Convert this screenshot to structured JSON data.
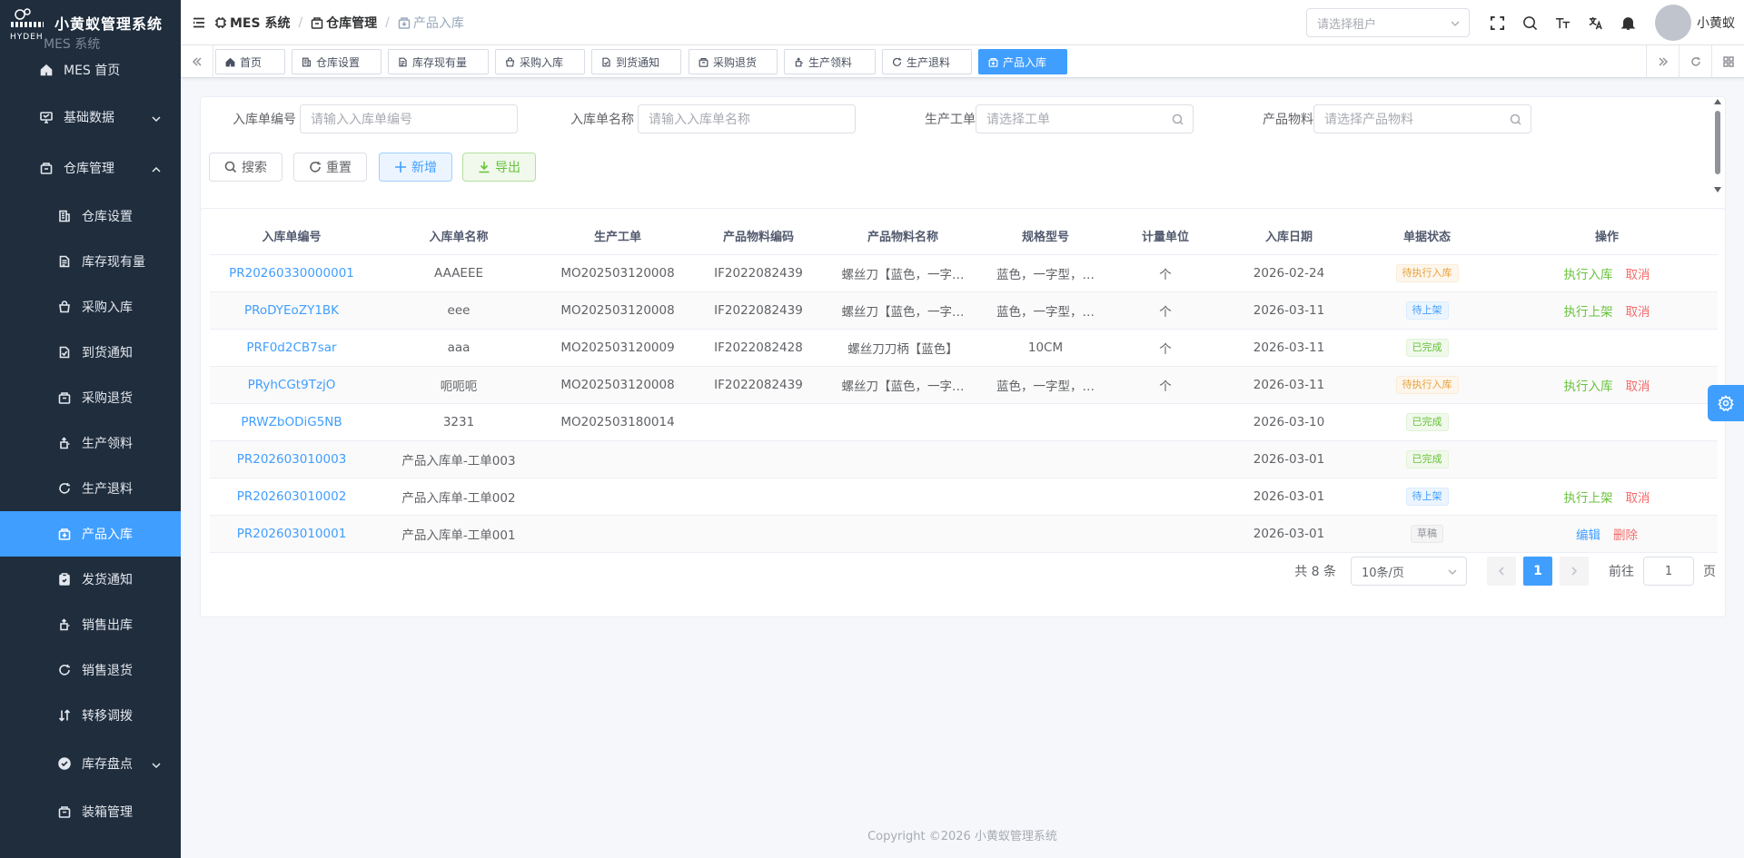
{
  "app": {
    "title": "小黄蚁管理系统",
    "logo_sub": "MES 系统"
  },
  "sidebar": {
    "items": [
      {
        "label": "MES 首页",
        "icon": "home-icon"
      },
      {
        "label": "基础数据",
        "icon": "monitor-icon",
        "expandable": true
      },
      {
        "label": "仓库管理",
        "icon": "warehouse-icon",
        "expandable": true,
        "expanded": true
      },
      {
        "label": "仓库设置",
        "icon": "building-icon",
        "sub": true
      },
      {
        "label": "库存现有量",
        "icon": "document-icon",
        "sub": true
      },
      {
        "label": "采购入库",
        "icon": "bag-icon",
        "sub": true
      },
      {
        "label": "到货通知",
        "icon": "document-check-icon",
        "sub": true
      },
      {
        "label": "采购退货",
        "icon": "box-icon",
        "sub": true
      },
      {
        "label": "生产领料",
        "icon": "pull-icon",
        "sub": true
      },
      {
        "label": "生产退料",
        "icon": "refresh-icon",
        "sub": true
      },
      {
        "label": "产品入库",
        "icon": "box-in-icon",
        "sub": true,
        "active": true
      },
      {
        "label": "发货通知",
        "icon": "clipboard-icon",
        "sub": true
      },
      {
        "label": "销售出库",
        "icon": "pull-icon",
        "sub": true
      },
      {
        "label": "销售退货",
        "icon": "refresh-icon",
        "sub": true
      },
      {
        "label": "转移调拨",
        "icon": "sort-icon",
        "sub": true
      },
      {
        "label": "库存盘点",
        "icon": "check-circle-icon",
        "sub": true,
        "expandable": true
      },
      {
        "label": "装箱管理",
        "icon": "box-icon",
        "sub": true
      }
    ]
  },
  "header": {
    "breadcrumb": [
      "MES 系统",
      "仓库管理",
      "产品入库"
    ],
    "tenant_placeholder": "请选择租户",
    "username": "小黄蚁"
  },
  "tags": [
    "首页",
    "仓库设置",
    "库存现有量",
    "采购入库",
    "到货通知",
    "采购退货",
    "生产领料",
    "生产退料",
    "产品入库"
  ],
  "search": {
    "fields": [
      {
        "label": "入库单编号",
        "placeholder": "请输入入库单编号"
      },
      {
        "label": "入库单名称",
        "placeholder": "请输入入库单名称"
      },
      {
        "label": "生产工单",
        "placeholder": "请选择工单"
      },
      {
        "label": "产品物料",
        "placeholder": "请选择产品物料"
      }
    ],
    "buttons": {
      "search": "搜索",
      "reset": "重置",
      "add": "新增",
      "export": "导出"
    }
  },
  "table": {
    "columns": [
      "入库单编号",
      "入库单名称",
      "生产工单",
      "产品物料编码",
      "产品物料名称",
      "规格型号",
      "计量单位",
      "入库日期",
      "单据状态",
      "操作"
    ],
    "rows": [
      {
        "code": "PR20260330000001",
        "name": "AAAEEE",
        "wo": "MO202503120008",
        "mat_code": "IF2022082439",
        "mat_name": "螺丝刀【蓝色，一字…",
        "spec": "蓝色，一字型，…",
        "unit": "个",
        "date": "2026-02-24",
        "status": "待执行入库",
        "status_type": "warning",
        "ops": [
          {
            "label": "执行入库",
            "type": "green"
          },
          {
            "label": "取消",
            "type": "red"
          }
        ]
      },
      {
        "code": "PRoDYEoZY1BK",
        "name": "eee",
        "wo": "MO202503120008",
        "mat_code": "IF2022082439",
        "mat_name": "螺丝刀【蓝色，一字…",
        "spec": "蓝色，一字型，…",
        "unit": "个",
        "date": "2026-03-11",
        "status": "待上架",
        "status_type": "primary",
        "ops": [
          {
            "label": "执行上架",
            "type": "green"
          },
          {
            "label": "取消",
            "type": "red"
          }
        ]
      },
      {
        "code": "PRF0d2CB7sar",
        "name": "aaa",
        "wo": "MO202503120009",
        "mat_code": "IF2022082428",
        "mat_name": "螺丝刀刀柄【蓝色】",
        "spec": "10CM",
        "unit": "个",
        "date": "2026-03-11",
        "status": "已完成",
        "status_type": "success",
        "ops": []
      },
      {
        "code": "PRyhCGt9TzjO",
        "name": "呃呃呃",
        "wo": "MO202503120008",
        "mat_code": "IF2022082439",
        "mat_name": "螺丝刀【蓝色，一字…",
        "spec": "蓝色，一字型，…",
        "unit": "个",
        "date": "2026-03-11",
        "status": "待执行入库",
        "status_type": "warning",
        "ops": [
          {
            "label": "执行入库",
            "type": "green"
          },
          {
            "label": "取消",
            "type": "red"
          }
        ]
      },
      {
        "code": "PRWZbODiG5NB",
        "name": "3231",
        "wo": "MO202503180014",
        "mat_code": "",
        "mat_name": "",
        "spec": "",
        "unit": "",
        "date": "2026-03-10",
        "status": "已完成",
        "status_type": "success",
        "ops": []
      },
      {
        "code": "PR202603010003",
        "name": "产品入库单-工单003",
        "wo": "",
        "mat_code": "",
        "mat_name": "",
        "spec": "",
        "unit": "",
        "date": "2026-03-01",
        "status": "已完成",
        "status_type": "success",
        "ops": []
      },
      {
        "code": "PR202603010002",
        "name": "产品入库单-工单002",
        "wo": "",
        "mat_code": "",
        "mat_name": "",
        "spec": "",
        "unit": "",
        "date": "2026-03-01",
        "status": "待上架",
        "status_type": "primary",
        "ops": [
          {
            "label": "执行上架",
            "type": "green"
          },
          {
            "label": "取消",
            "type": "red"
          }
        ]
      },
      {
        "code": "PR202603010001",
        "name": "产品入库单-工单001",
        "wo": "",
        "mat_code": "",
        "mat_name": "",
        "spec": "",
        "unit": "",
        "date": "2026-03-01",
        "status": "草稿",
        "status_type": "info",
        "ops": [
          {
            "label": "编辑",
            "type": "blue"
          },
          {
            "label": "删除",
            "type": "red"
          }
        ]
      }
    ]
  },
  "pagination": {
    "total": "共 8 条",
    "page_size": "10条/页",
    "current": "1",
    "goto_label": "前往",
    "goto_value": "1",
    "page_suffix": "页"
  },
  "footer": "Copyright ©2026 小黄蚁管理系统",
  "colors": {
    "primary": "#409eff",
    "sidebar_bg": "#1f2d3d",
    "success": "#67c23a",
    "danger": "#f56c6c",
    "warning": "#e6a23c"
  }
}
